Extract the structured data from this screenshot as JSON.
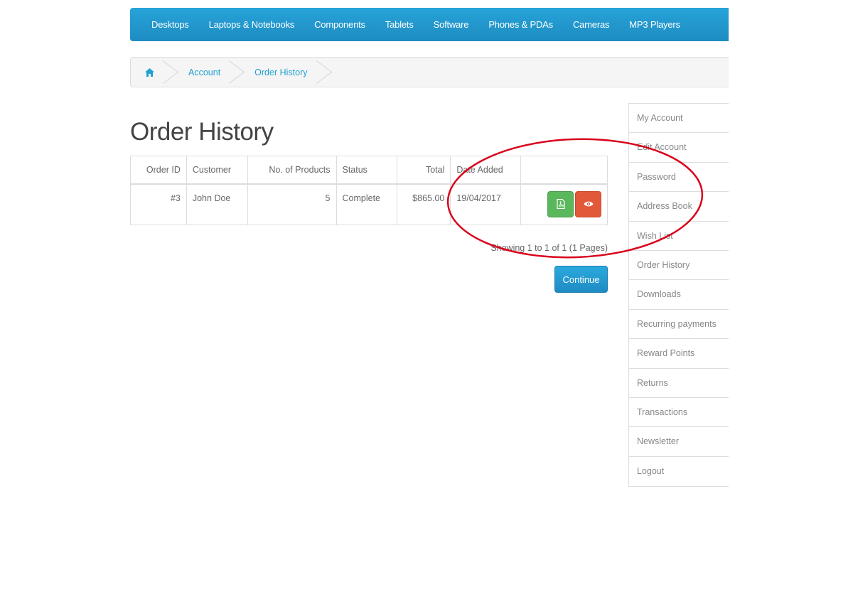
{
  "topnav": {
    "items": [
      "Desktops",
      "Laptops & Notebooks",
      "Components",
      "Tablets",
      "Software",
      "Phones & PDAs",
      "Cameras",
      "MP3 Players"
    ]
  },
  "breadcrumb": {
    "home_icon": "home-icon",
    "items": [
      "Account",
      "Order History"
    ]
  },
  "page": {
    "title": "Order History"
  },
  "table": {
    "headers": [
      "Order ID",
      "Customer",
      "No. of Products",
      "Status",
      "Total",
      "Date Added",
      ""
    ],
    "rows": [
      {
        "order_id": "#3",
        "customer": "John Doe",
        "products": "5",
        "status": "Complete",
        "total": "$865.00",
        "date_added": "19/04/2017"
      }
    ],
    "actions": {
      "invoice_icon": "file-pdf-icon",
      "view_icon": "eye-icon"
    }
  },
  "pagination": {
    "text": "Showing 1 to 1 of 1 (1 Pages)"
  },
  "continue_label": "Continue",
  "sidebar": {
    "items": [
      "My Account",
      "Edit Account",
      "Password",
      "Address Book",
      "Wish List",
      "Order History",
      "Downloads",
      "Recurring payments",
      "Reward Points",
      "Returns",
      "Transactions",
      "Newsletter",
      "Logout"
    ]
  },
  "colors": {
    "nav": "#1e8cc2",
    "link": "#23a1d1",
    "green_button": "#5bb75b",
    "red_button": "#e2593a",
    "annotation": "#d9001b"
  }
}
